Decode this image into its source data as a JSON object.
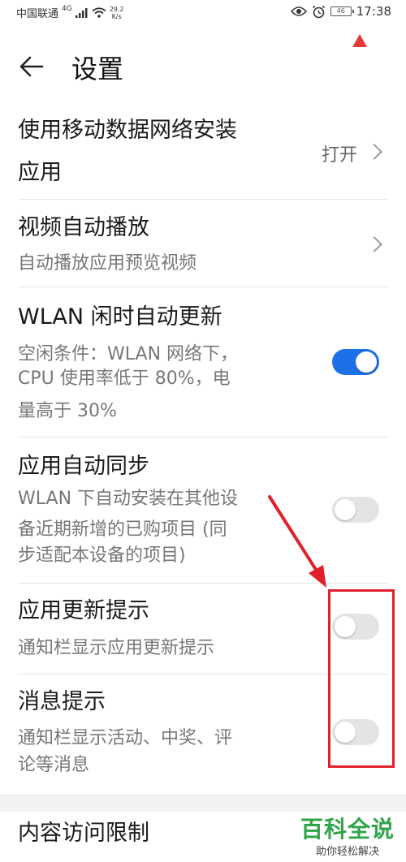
{
  "status_bar": {
    "carrier": "中国联通",
    "network": "4G",
    "speed_value": "29.2",
    "speed_unit": "K/s",
    "battery": "46",
    "time": "17:38"
  },
  "header": {
    "title": "设置"
  },
  "items": [
    {
      "title_line1": "使用移动数据网络安装",
      "title_line2": "应用",
      "value": "打开"
    },
    {
      "title": "视频自动播放",
      "subtitle": "自动播放应用预览视频"
    },
    {
      "title": "WLAN 闲时自动更新",
      "subtitle_lines": [
        "空闲条件：WLAN 网络下，",
        "CPU 使用率低于 80%，电",
        "量高于 30%"
      ],
      "toggle_on": true
    },
    {
      "title": "应用自动同步",
      "subtitle_lines": [
        "WLAN 下自动安装在其他设",
        "备近期新增的已购项目 (同",
        "步适配本设备的项目)"
      ],
      "toggle_on": false
    },
    {
      "title": "应用更新提示",
      "subtitle": "通知栏显示应用更新提示",
      "toggle_on": false
    },
    {
      "title": "消息提示",
      "subtitle_lines": [
        "通知栏显示活动、中奖、评",
        "论等消息"
      ],
      "toggle_on": false
    },
    {
      "title": "内容访问限制"
    }
  ],
  "annotation": {
    "color": "#e0202a"
  },
  "watermark": {
    "main": "百科全说",
    "sub": "助你轻松解决"
  },
  "colors": {
    "toggle_on": "#1e70e8",
    "toggle_off": "#e4e4e4",
    "watermark": "#2fa44a"
  }
}
